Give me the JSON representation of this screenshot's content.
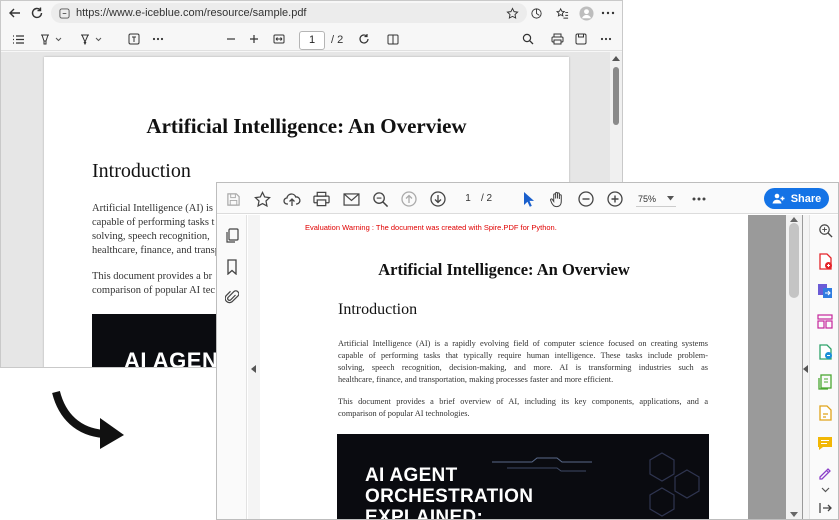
{
  "browser": {
    "url": "https://www.e-iceblue.com/resource/sample.pdf",
    "toolbar": {
      "page_number": "1",
      "page_total": "/ 2"
    },
    "document": {
      "title": "Artificial Intelligence: An Overview",
      "heading": "Introduction",
      "lines": [
        "Artificial Intelligence (AI) is a",
        "capable of performing tasks t",
        "solving, speech recognition,",
        "healthcare, finance, and transp"
      ],
      "lines2": [
        "This document provides a br",
        "comparison of popular AI tec"
      ],
      "image_text": "AI AGENT"
    }
  },
  "acrobat": {
    "toolbar": {
      "page_number": "1",
      "page_total": "/ 2",
      "zoom": "75%",
      "share_label": "Share"
    },
    "document": {
      "warning": "Evaluation Warning : The document was created with Spire.PDF for Python.",
      "title": "Artificial Intelligence: An Overview",
      "heading": "Introduction",
      "paragraph1": [
        "Artificial Intelligence (AI) is a rapidly evolving field of computer science focused on creating systems",
        "capable of performing tasks that typically require human intelligence. These tasks include problem-",
        "solving, speech recognition, decision-making, and more. AI is transforming industries such as",
        "healthcare, finance, and transportation, making processes faster and more efficient."
      ],
      "paragraph2": [
        "This document provides a brief overview of AI, including its key components, applications, and a",
        "comparison of popular AI technologies."
      ],
      "image_lines": [
        "AI AGENT",
        "ORCHESTRATION",
        "EXPLAINED:"
      ]
    }
  },
  "colors": {
    "share_blue": "#1473e6",
    "warning_red": "#e00000",
    "dark_image": "#0a0b10"
  }
}
